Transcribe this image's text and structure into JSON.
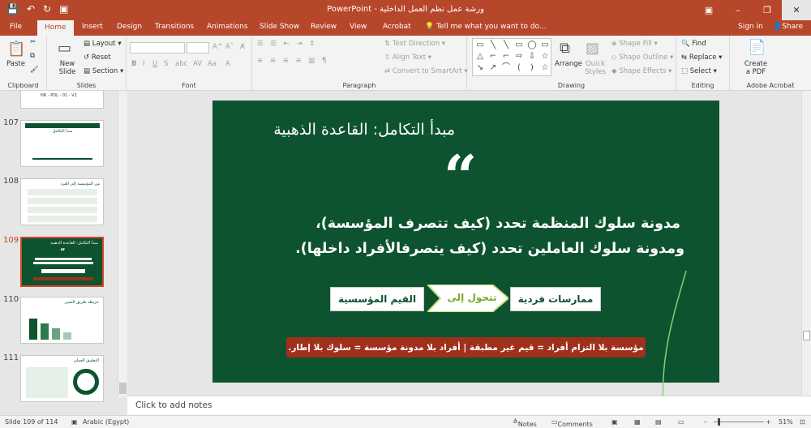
{
  "window": {
    "title": "ورشة عمل نظم العمل الداخلية - PowerPoint",
    "controls": [
      "▣",
      "–",
      "❐",
      "✕"
    ]
  },
  "qat": {
    "save": "💾",
    "undo": "↶",
    "redo": "↻",
    "present": "▣"
  },
  "tabs": [
    "File",
    "Home",
    "Insert",
    "Design",
    "Transitions",
    "Animations",
    "Slide Show",
    "Review",
    "View",
    "Acrobat"
  ],
  "active_tab": "Home",
  "tell_me": "Tell me what you want to do...",
  "sign_in": "Sign in",
  "share": "Share",
  "ribbon": {
    "clipboard": {
      "paste": "Paste",
      "label": "Clipboard"
    },
    "slides": {
      "new_slide": "New Slide",
      "layout": "Layout",
      "reset": "Reset",
      "section": "Section",
      "label": "Slides"
    },
    "font": {
      "label": "Font"
    },
    "paragraph": {
      "text_direction": "Text Direction",
      "align_text": "Align Text",
      "convert_smartart": "Convert to SmartArt",
      "label": "Paragraph"
    },
    "drawing": {
      "arrange": "Arrange",
      "quick_styles": "Quick Styles",
      "shape_fill": "Shape Fill",
      "shape_outline": "Shape Outline",
      "shape_effects": "Shape Effects",
      "label": "Drawing"
    },
    "editing": {
      "find": "Find",
      "replace": "Replace",
      "select": "Select",
      "label": "Editing"
    },
    "acrobat": {
      "create_pdf": "Create a PDF",
      "label": "Adobe Acrobat"
    }
  },
  "thumbnails": [
    {
      "num": "107",
      "title": "مبدأ التكامل"
    },
    {
      "num": "108",
      "title": "من المؤسسة إلى الفرد"
    },
    {
      "num": "109",
      "title": "مبدأ التكامل: القاعدة الذهبية"
    },
    {
      "num": "110",
      "title": "خريطة طريق التغيير"
    },
    {
      "num": "111",
      "title": "التطبيق العملي"
    }
  ],
  "thumb_top_text": "HR - POL - 01 - V1",
  "slide": {
    "title": "مبدأ التكامل: القاعدة الذهبية",
    "quote": "“",
    "line1": "مدونة سلوك المنظمة تحدد (كيف تتصرف المؤسسة)،",
    "line2": "ومدونة سلوك العاملين تحدد (كيف يتصرفالأفراد داخلها).",
    "box_left": "القيم المؤسسية",
    "arrow_text": "تتحول إلى",
    "box_right": "ممارسات فردية",
    "banner": "مؤسسة بلا التزام أفراد = قيم غير مطبقة | أفراد بلا مدونة مؤسسة = سلوك بلا إطار."
  },
  "notes_placeholder": "Click to add notes",
  "status": {
    "slide_info": "Slide 109 of 114",
    "language": "Arabic (Egypt)",
    "notes": "Notes",
    "comments": "Comments",
    "zoom": "51%"
  },
  "colors": {
    "brand": "#b7472a",
    "slide_bg": "#0e5330",
    "banner": "#a0301b",
    "arrow": "#c7e07a"
  }
}
